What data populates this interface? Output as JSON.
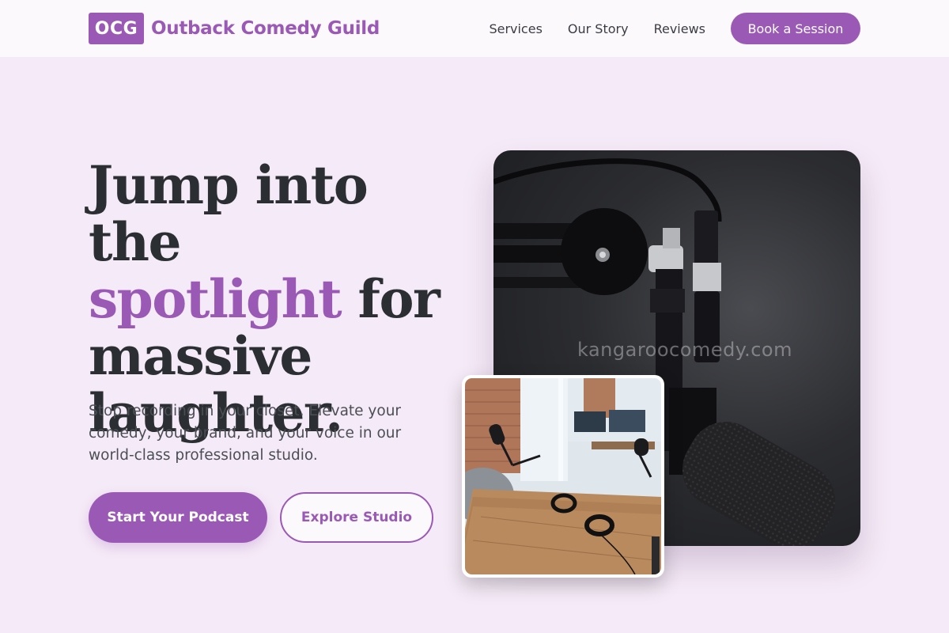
{
  "brand": {
    "badge": "OCG",
    "name": "Outback Comedy Guild",
    "accent_color": "#9b59b6"
  },
  "nav": {
    "links": [
      "Services",
      "Our Story",
      "Reviews"
    ],
    "cta": "Book a Session"
  },
  "hero": {
    "title_line1": "Jump into the",
    "title_accent": "spotlight",
    "title_line2_rest": " for",
    "title_line3": "massive",
    "title_line4": "laughter.",
    "subtitle": "Stop recording in your closet. Elevate your comedy, your brand, and your voice in our world-class professional studio.",
    "primary_button": "Start Your Podcast",
    "secondary_button": "Explore Studio"
  },
  "images": {
    "main_watermark": "kangaroocomedy.com",
    "main_icon": "microphone-photo",
    "inset_icon": "studio-desk-photo"
  }
}
